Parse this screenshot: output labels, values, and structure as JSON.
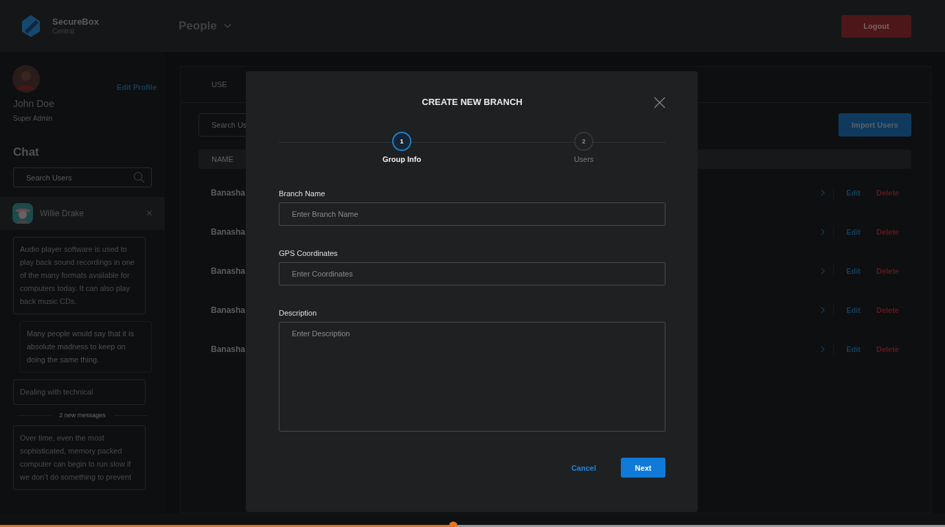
{
  "brand": {
    "name": "SecureBox",
    "sub": "Central"
  },
  "header": {
    "section": "People",
    "logout": "Logout"
  },
  "profile": {
    "name": "John Doe",
    "role": "Super Admin",
    "edit": "Edit Profile"
  },
  "chat": {
    "title": "Chat",
    "search_placeholder": "Search Users",
    "contact": {
      "name": "Willie Drake",
      "close": "×"
    },
    "messages": [
      {
        "kind": "incoming",
        "text": "Audio player software is used to play back sound recordings in one of the many formats available for computers today. It can also play back music CDs."
      },
      {
        "kind": "outgoing",
        "text": "Many people would say that it is absolute madness to keep on doing the same thing."
      },
      {
        "kind": "incoming",
        "text": "Dealing with technical"
      },
      {
        "kind": "divider",
        "text": "2 new messages"
      },
      {
        "kind": "incoming",
        "text": "Over time, even the most sophisticated, memory packed computer can begin to run slow if we don’t do something to prevent"
      }
    ]
  },
  "users_panel": {
    "tab": "USE",
    "search_placeholder": "Search Us",
    "import": "Import Users",
    "column_1": "NAME",
    "rows": [
      {
        "name": "Banasha",
        "edit": "Edit",
        "delete": "Delete"
      },
      {
        "name": "Banasha",
        "edit": "Edit",
        "delete": "Delete"
      },
      {
        "name": "Banasha",
        "edit": "Edit",
        "delete": "Delete"
      },
      {
        "name": "Banasha",
        "edit": "Edit",
        "delete": "Delete"
      },
      {
        "name": "Banasha",
        "edit": "Edit",
        "delete": "Delete"
      }
    ]
  },
  "modal": {
    "title": "CREATE NEW BRANCH",
    "steps": [
      {
        "number": "1",
        "label": "Group Info",
        "selected": true
      },
      {
        "number": "2",
        "label": "Users",
        "selected": false
      }
    ],
    "fields": [
      {
        "kind": "input",
        "label": "Branch Name",
        "placeholder": "Enter Branch Name"
      },
      {
        "kind": "input",
        "label": "GPS Coordinates",
        "placeholder": "Enter Coordinates"
      },
      {
        "kind": "textarea",
        "label": "Description",
        "placeholder": "Enter Description"
      }
    ],
    "cancel": "Cancel",
    "next": "Next"
  },
  "video_progress": {
    "level": 0.48
  }
}
